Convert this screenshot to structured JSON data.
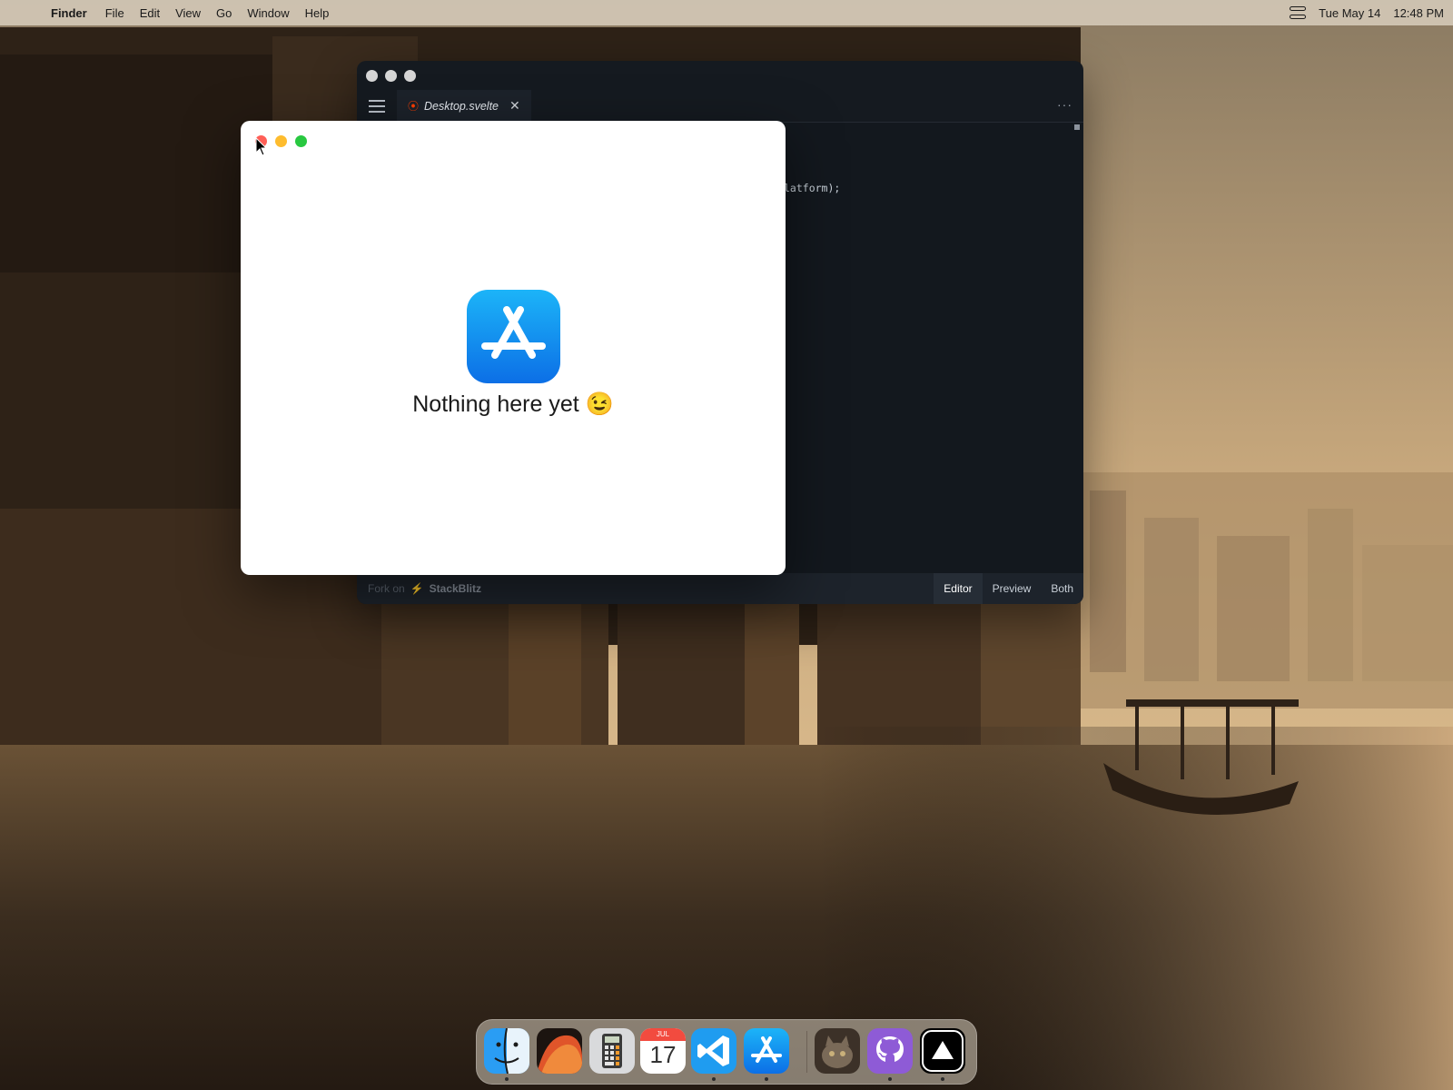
{
  "menubar": {
    "apple_glyph": "",
    "app_name": "Finder",
    "menus": [
      "File",
      "Edit",
      "View",
      "Go",
      "Window",
      "Help"
    ],
    "date": "Tue May 14",
    "time": "12:48 PM"
  },
  "editor": {
    "tab_label": "Desktop.svelte",
    "tab_icon": "svelte-icon",
    "code_snippet": "latform);",
    "more_label": "···",
    "footer": {
      "fork_label": "Fork on",
      "brand": "StackBlitz",
      "view_modes": [
        "Editor",
        "Preview",
        "Both"
      ],
      "active_mode": "Editor"
    }
  },
  "preview": {
    "icon": "app-store-icon",
    "message": "Nothing here yet 😉"
  },
  "dock": {
    "apps": [
      {
        "name": "Finder",
        "icon": "finder-icon",
        "running": true
      },
      {
        "name": "macOS Wallpaper",
        "icon": "wallpaper-icon",
        "running": false
      },
      {
        "name": "Calculator",
        "icon": "calculator-icon",
        "running": false
      },
      {
        "name": "Calendar",
        "icon": "calendar-icon",
        "running": false,
        "month": "JUL",
        "day": "17"
      },
      {
        "name": "VS Code",
        "icon": "vscode-icon",
        "running": true
      },
      {
        "name": "App Store",
        "icon": "app-store-icon",
        "running": true
      },
      {
        "name": "Cat Photo",
        "icon": "cat-photo-icon",
        "running": false
      },
      {
        "name": "GitHub",
        "icon": "github-icon",
        "running": true
      },
      {
        "name": "Vercel",
        "icon": "vercel-icon",
        "running": true
      }
    ]
  },
  "colors": {
    "accent_blue": "#0c6fe6",
    "close_red": "#ff5f57",
    "minimize_yellow": "#febc2e",
    "maximize_green": "#28c840",
    "svelte_orange": "#ff3e00"
  }
}
